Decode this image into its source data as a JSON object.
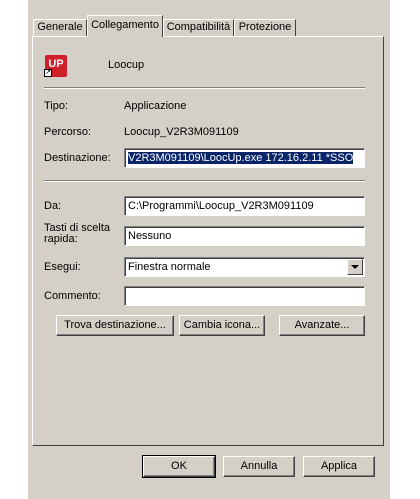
{
  "tabs": [
    "Generale",
    "Collegamento",
    "Compatibilità",
    "Protezione"
  ],
  "app": {
    "name": "Loocup",
    "icon": "up-app-icon",
    "icon_text": "UP"
  },
  "info": {
    "type_label": "Tipo:",
    "type_value": "Applicazione",
    "path_label": "Percorso:",
    "path_value": "Loocup_V2R3M091109",
    "dest_label": "Destinazione:",
    "dest_value": "V2R3M091109\\LoocUp.exe 172.16.2.11 *SSO"
  },
  "form": {
    "start_label": "Da:",
    "start_value": "C:\\Programmi\\Loocup_V2R3M091109",
    "hotkey_label": "Tasti di scelta rapida:",
    "hotkey_value": "Nessuno",
    "run_label": "Esegui:",
    "run_value": "Finestra normale",
    "comment_label": "Commento:",
    "comment_value": ""
  },
  "buttons": {
    "find_target": "Trova destinazione...",
    "change_icon": "Cambia icona...",
    "advanced": "Avanzate...",
    "ok": "OK",
    "cancel": "Annulla",
    "apply": "Applica"
  },
  "colors": {
    "dialog_bg": "#d4d0c8",
    "selection": "#0a246a",
    "icon_red": "#d0202a"
  }
}
